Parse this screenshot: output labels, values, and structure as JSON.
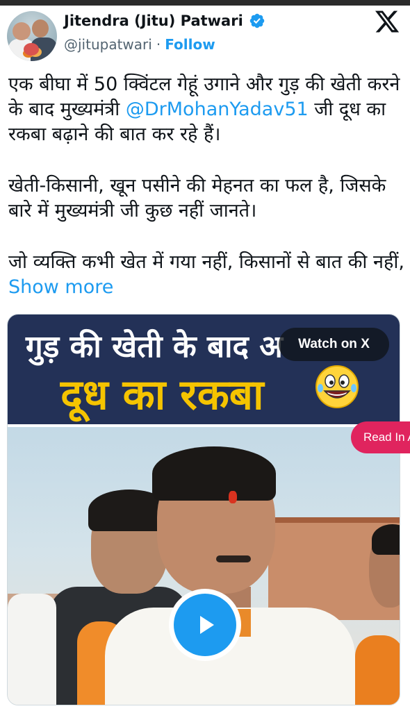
{
  "author": {
    "display_name": "Jitendra (Jitu) Patwari",
    "handle": "@jitupatwari",
    "separator": "·",
    "follow_label": "Follow",
    "verified": true
  },
  "tweet": {
    "para1_before_mention": "एक बीघा में 50 क्विंटल गेहूं उगाने और गुड़ की खेती करने के बाद मुख्यमंत्री ",
    "para1_mention": "@DrMohanYadav51",
    "para1_after_mention": " जी दूध का रकबा बढ़ाने की बात कर रहे हैं।",
    "para2": "खेती-किसानी, खून पसीने की मेहनत का फल है, जिसके बारे में मुख्यमंत्री जी कुछ नहीं जानते।",
    "para3": "जो व्यक्ति कभी खेत में गया नहीं, किसानों से बात की नहीं, ",
    "show_more": "Show more"
  },
  "media": {
    "banner_line1": "गुड़ की खेती के बाद अ",
    "banner_line2": "दूध का रकबा",
    "watch_on_x": "Watch on X",
    "read_in": "Read In A"
  },
  "colors": {
    "accent": "#1d9bf0",
    "banner_bg": "#233157",
    "banner_highlight": "#f5c400",
    "read_pill": "#e0245e"
  },
  "icons": [
    "verified-badge-icon",
    "x-logo-icon",
    "play-icon",
    "laughing-emoji-icon"
  ]
}
